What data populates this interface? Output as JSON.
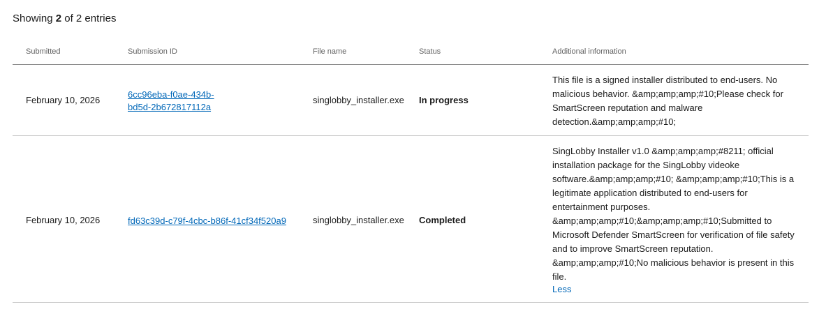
{
  "summary": {
    "prefix": "Showing ",
    "count": "2",
    "suffix": " of 2 entries"
  },
  "table": {
    "headers": {
      "submitted": "Submitted",
      "submission_id": "Submission ID",
      "file_name": "File name",
      "status": "Status",
      "additional_info": "Additional information"
    },
    "rows": [
      {
        "submitted": "February 10, 2026",
        "submission_id": "6cc96eba-f0ae-434b-bd5d-2b672817112a",
        "file_name": "singlobby_installer.exe",
        "status": "In progress",
        "additional_info": "This file is a signed installer distributed to end-users. No malicious behavior. &amp;amp;amp;#10;Please check for SmartScreen reputation and malware detection.&amp;amp;amp;#10;"
      },
      {
        "submitted": "February 10, 2026",
        "submission_id": "fd63c39d-c79f-4cbc-b86f-41cf34f520a9",
        "file_name": "singlobby_installer.exe",
        "status": "Completed",
        "additional_info": "SingLobby Installer v1.0 &amp;amp;amp;#8211; official installation package for the SingLobby videoke software.&amp;amp;amp;#10; &amp;amp;amp;#10;This is a legitimate application distributed to end-users for entertainment purposes. &amp;amp;amp;#10;&amp;amp;amp;#10;Submitted to Microsoft Defender SmartScreen for verification of file safety and to improve SmartScreen reputation. &amp;amp;amp;#10;No malicious behavior is present in this file.",
        "toggle_label": "Less"
      }
    ]
  },
  "colors": {
    "link": "#0067b8",
    "text": "#1b1b1b",
    "header_text": "#616161",
    "header_rule": "#8a8a8a",
    "row_rule": "#c8c8c8"
  }
}
